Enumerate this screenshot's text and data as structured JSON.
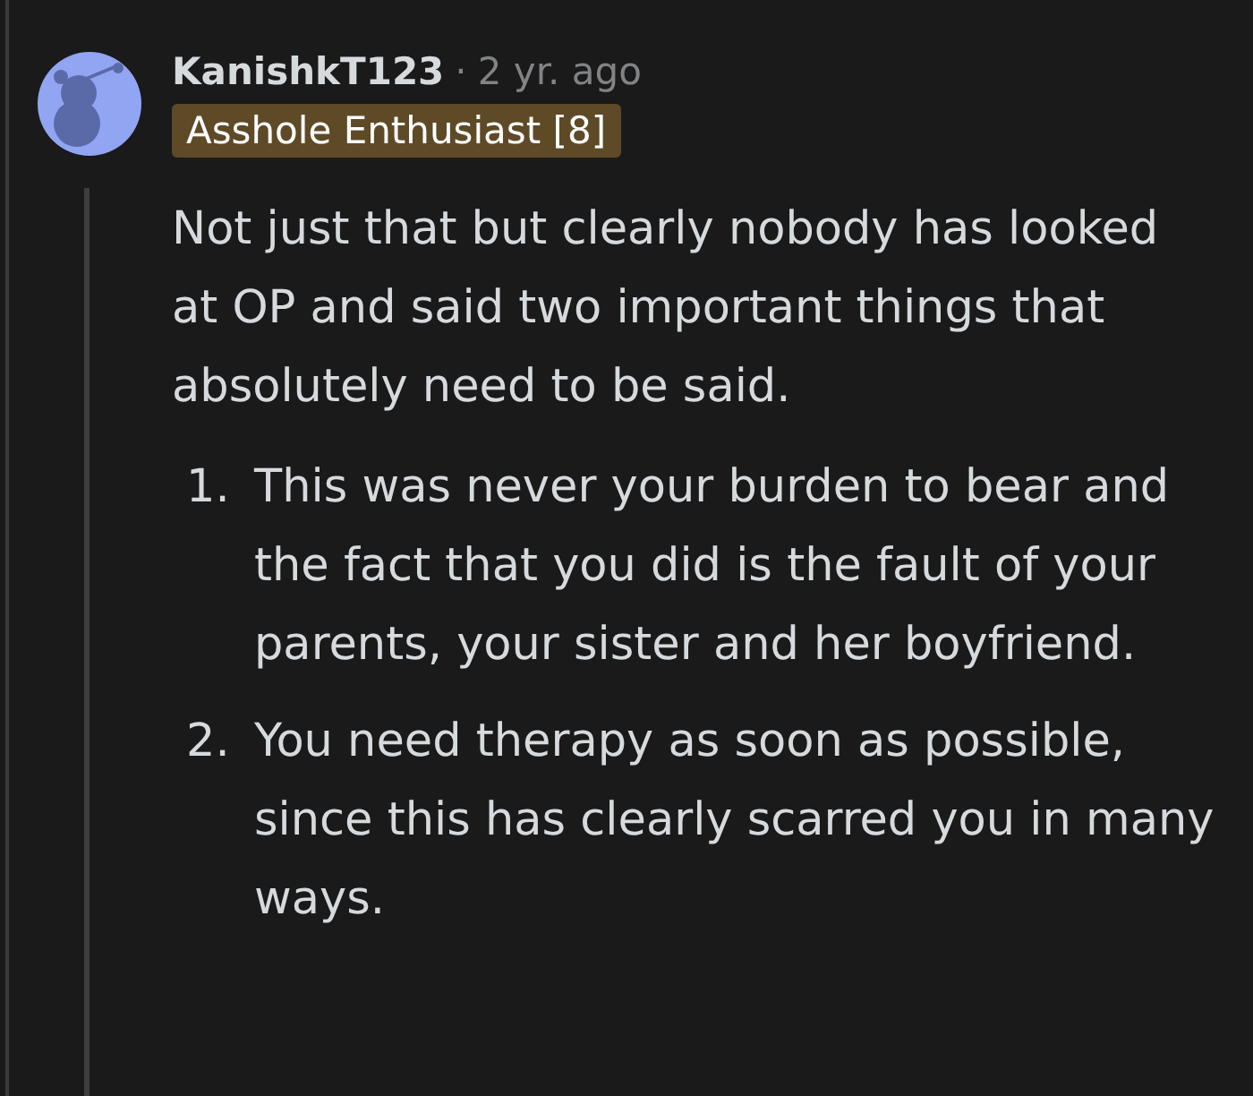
{
  "comment": {
    "author": "KanishkT123",
    "separator": "·",
    "time": "2 yr. ago",
    "flair": "Asshole Enthusiast [8]",
    "paragraph": "Not just that but clearly nobody has looked at OP and said two important things that absolutely need to be said.",
    "list": [
      {
        "number": "1.",
        "text": "This was never your burden to bear and the fact that you did is the fault of your parents, your sister and her boyfriend."
      },
      {
        "number": "2.",
        "text": "You need therapy as soon as possible, since this has clearly scarred you in many ways."
      }
    ]
  }
}
